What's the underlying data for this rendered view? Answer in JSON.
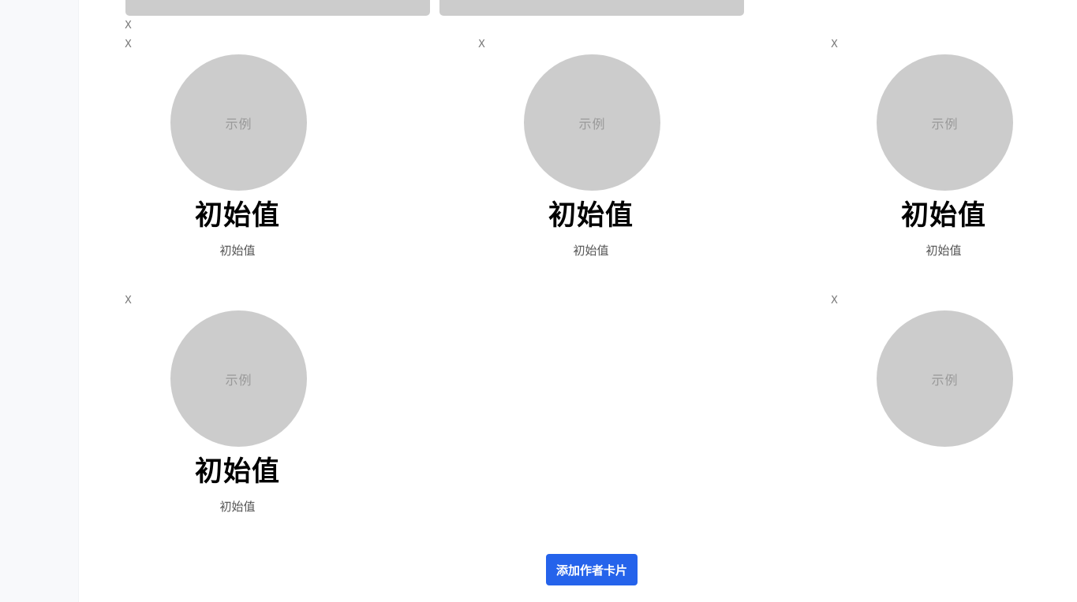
{
  "close_label": "X",
  "cards": [
    {
      "avatar_text": "示例",
      "name": "初始值",
      "subtitle": "初始值"
    },
    {
      "avatar_text": "示例",
      "name": "初始值",
      "subtitle": "初始值"
    },
    {
      "avatar_text": "示例",
      "name": "初始值",
      "subtitle": "初始值"
    },
    {
      "avatar_text": "示例",
      "name": "初始值",
      "subtitle": "初始值"
    },
    {
      "avatar_text": "示例"
    }
  ],
  "add_button": {
    "label": "添加作者卡片"
  },
  "colors": {
    "avatar_bg": "#cccccc",
    "button_bg": "#2563eb",
    "sidebar_bg": "#f8f9fb"
  }
}
